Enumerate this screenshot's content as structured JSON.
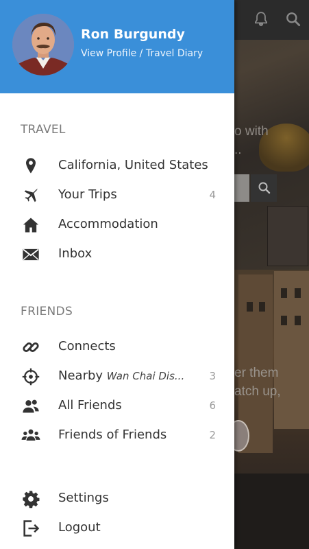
{
  "background": {
    "text_1": [
      "o with",
      ".."
    ],
    "text_2": [
      "er them",
      "atch up,"
    ]
  },
  "profile": {
    "name": "Ron Burgundy",
    "links": "View Profile / Travel Diary"
  },
  "sections": [
    {
      "title": "TRAVEL",
      "items": [
        {
          "icon": "location-pin-icon",
          "label": "California, United States",
          "count": ""
        },
        {
          "icon": "airplane-icon",
          "label": "Your Trips",
          "count": "4"
        },
        {
          "icon": "home-icon",
          "label": "Accommodation",
          "count": ""
        },
        {
          "icon": "envelope-icon",
          "label": "Inbox",
          "count": ""
        }
      ]
    },
    {
      "title": "FRIENDS",
      "items": [
        {
          "icon": "link-icon",
          "label": "Connects",
          "count": ""
        },
        {
          "icon": "crosshair-icon",
          "label": "Nearby",
          "sublabel": "Wan Chai Dis...",
          "count": "3"
        },
        {
          "icon": "users-icon",
          "label": "All Friends",
          "count": "6"
        },
        {
          "icon": "users-group-icon",
          "label": "Friends of Friends",
          "count": "2"
        }
      ]
    }
  ],
  "footer_items": [
    {
      "icon": "gear-icon",
      "label": "Settings"
    },
    {
      "icon": "logout-icon",
      "label": "Logout"
    }
  ],
  "colors": {
    "header_bg": "#3a8fd9",
    "icon": "#333333",
    "section_title": "#7a7a7a"
  }
}
